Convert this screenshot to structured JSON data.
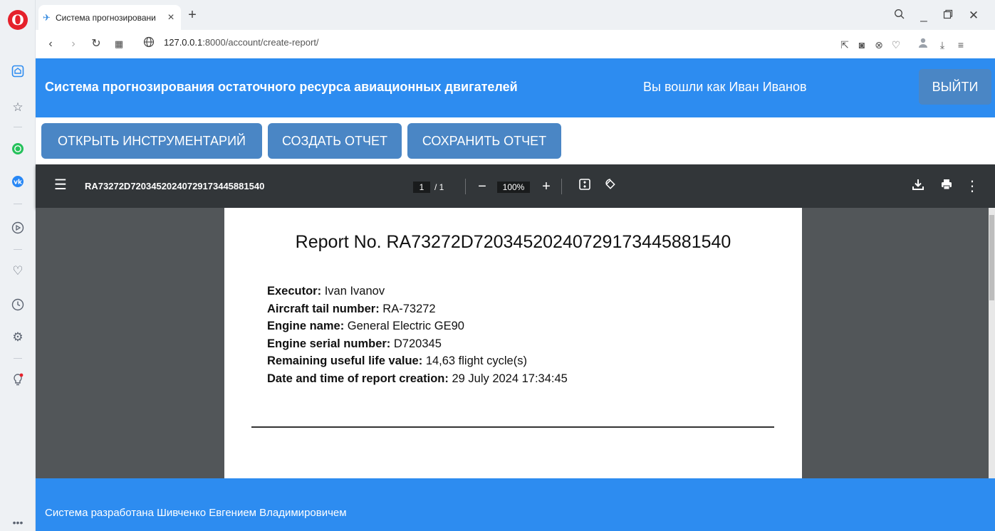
{
  "browser": {
    "tab_title": "Система прогнозировани",
    "url_host": "127.0.0.1",
    "url_rest": ":8000/account/create-report/"
  },
  "header": {
    "title": "Система прогнозирования остаточного ресурса авиационных двигателей",
    "user_label": "Вы вошли как Иван Иванов",
    "logout": "ВЫЙТИ"
  },
  "actions": {
    "open_tools": "ОТКРЫТЬ ИНСТРУМЕНТАРИЙ",
    "create_report": "СОЗДАТЬ ОТЧЕТ",
    "save_report": "СОХРАНИТЬ ОТЧЕТ"
  },
  "pdf_viewer": {
    "file_name": "RA73272D72034520240729173445881540",
    "current_page": "1",
    "total_pages": "/ 1",
    "zoom": "100%"
  },
  "report": {
    "title": "Report No. RA73272D72034520240729173445881540",
    "fields": [
      {
        "label": "Executor:",
        "value": "Ivan Ivanov"
      },
      {
        "label": "Aircraft tail number:",
        "value": "RA-73272"
      },
      {
        "label": "Engine name:",
        "value": "General Electric GE90"
      },
      {
        "label": "Engine serial number:",
        "value": "D720345"
      },
      {
        "label": "Remaining useful life value:",
        "value": "14,63 flight cycle(s)"
      },
      {
        "label": "Date and time of report creation:",
        "value": "29 July 2024 17:34:45"
      }
    ]
  },
  "footer": {
    "text": "Система разработана Шивченко Евгением Владимировичем"
  },
  "colors": {
    "accent": "#2d8cf0",
    "button": "#4a86c5",
    "pdf_toolbar": "#323639",
    "pdf_background": "#525659"
  }
}
